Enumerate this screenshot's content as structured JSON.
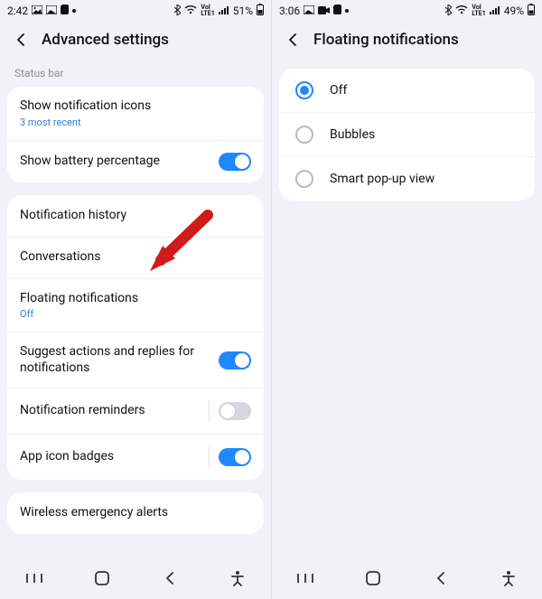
{
  "left": {
    "status": {
      "time": "2:42",
      "battery": "51%"
    },
    "header": {
      "title": "Advanced settings"
    },
    "section1_label": "Status bar",
    "rows": {
      "show_notif_icons": {
        "title": "Show notification icons",
        "sub": "3 most recent"
      },
      "show_battery_pct": {
        "title": "Show battery percentage"
      },
      "notif_history": {
        "title": "Notification history"
      },
      "conversations": {
        "title": "Conversations"
      },
      "floating_notif": {
        "title": "Floating notifications",
        "sub": "Off"
      },
      "suggest_actions": {
        "title": "Suggest actions and replies for notifications"
      },
      "notif_reminders": {
        "title": "Notification reminders"
      },
      "app_icon_badges": {
        "title": "App icon badges"
      },
      "wireless_emergency": {
        "title": "Wireless emergency alerts"
      }
    }
  },
  "right": {
    "status": {
      "time": "3:06",
      "battery": "49%"
    },
    "header": {
      "title": "Floating notifications"
    },
    "options": {
      "off": "Off",
      "bubbles": "Bubbles",
      "smart": "Smart pop-up view"
    }
  }
}
